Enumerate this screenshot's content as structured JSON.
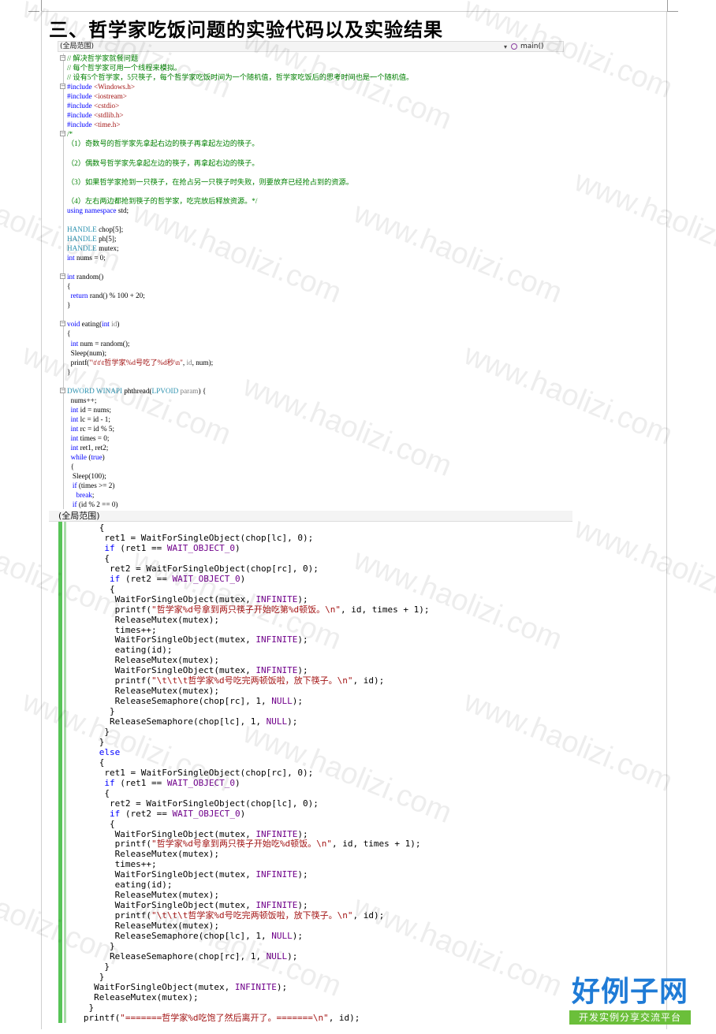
{
  "heading": "三、哲学家吃饭问题的实验代码以及实验结果",
  "top_editor": {
    "scope_label": "(全局范围)",
    "function_label": "main()",
    "lines": [
      [
        [
          "g",
          "// 解决哲学家就餐问题"
        ]
      ],
      [
        [
          "g",
          "// 每个哲学家可用一个线程来模拟。"
        ]
      ],
      [
        [
          "g",
          "// 设有5个哲学家，5只筷子，每个哲学家吃饭时间为一个随机值，哲学家吃饭后的思考时间也是一个随机值。"
        ]
      ],
      [
        [
          "b",
          "#include "
        ],
        [
          "s",
          "<Windows.h>"
        ]
      ],
      [
        [
          "b",
          "#include "
        ],
        [
          "s",
          "<iostream>"
        ]
      ],
      [
        [
          "b",
          "#include "
        ],
        [
          "s",
          "<cstdio>"
        ]
      ],
      [
        [
          "b",
          "#include "
        ],
        [
          "s",
          "<stdlib.h>"
        ]
      ],
      [
        [
          "b",
          "#include "
        ],
        [
          "s",
          "<time.h>"
        ]
      ],
      [
        [
          "g",
          "/*"
        ]
      ],
      [
        [
          "g",
          "（1）奇数号的哲学家先拿起右边的筷子再拿起左边的筷子。"
        ]
      ],
      [
        [
          "n",
          ""
        ]
      ],
      [
        [
          "g",
          "（2）偶数号哲学家先拿起左边的筷子，再拿起右边的筷子。"
        ]
      ],
      [
        [
          "n",
          ""
        ]
      ],
      [
        [
          "g",
          "（3）如果哲学家抢到一只筷子，在抢占另一只筷子时失败，则要放弃已经抢占到的资源。"
        ]
      ],
      [
        [
          "n",
          ""
        ]
      ],
      [
        [
          "g",
          "（4）左右两边都抢到筷子的哲学家，吃完放后释放资源。*/"
        ]
      ],
      [
        [
          "k",
          "using namespace"
        ],
        [
          "n",
          " std;"
        ]
      ],
      [
        [
          "n",
          ""
        ]
      ],
      [
        [
          "t",
          "HANDLE"
        ],
        [
          "n",
          " chop[5];"
        ]
      ],
      [
        [
          "t",
          "HANDLE"
        ],
        [
          "n",
          " ph[5];"
        ]
      ],
      [
        [
          "t",
          "HANDLE"
        ],
        [
          "n",
          " mutex;"
        ]
      ],
      [
        [
          "k",
          "int"
        ],
        [
          "n",
          " nums = 0;"
        ]
      ],
      [
        [
          "n",
          ""
        ]
      ],
      [
        [
          "k",
          "int"
        ],
        [
          "n",
          " random()"
        ]
      ],
      [
        [
          "n",
          "{"
        ]
      ],
      [
        [
          "n",
          "  "
        ],
        [
          "k",
          "return"
        ],
        [
          "n",
          " rand() % 100 + 20;"
        ]
      ],
      [
        [
          "n",
          "}"
        ]
      ],
      [
        [
          "n",
          ""
        ]
      ],
      [
        [
          "k",
          "void"
        ],
        [
          "n",
          " eating("
        ],
        [
          "k",
          "int"
        ],
        [
          "p",
          " id"
        ],
        [
          "n",
          ")"
        ]
      ],
      [
        [
          "n",
          "{"
        ]
      ],
      [
        [
          "n",
          "  "
        ],
        [
          "k",
          "int"
        ],
        [
          "n",
          " num = random();"
        ]
      ],
      [
        [
          "n",
          "  Sleep(num);"
        ]
      ],
      [
        [
          "n",
          "  printf("
        ],
        [
          "s",
          "\"\\t\\t\\t哲学家%d号吃了%d秒\\n\""
        ],
        [
          "n",
          ", "
        ],
        [
          "p",
          "id"
        ],
        [
          "n",
          ", num);"
        ]
      ],
      [
        [
          "n",
          "}"
        ]
      ],
      [
        [
          "n",
          ""
        ]
      ],
      [
        [
          "t",
          "DWORD WINAPI"
        ],
        [
          "n",
          " phthread("
        ],
        [
          "t",
          "LPVOID"
        ],
        [
          "p",
          " param"
        ],
        [
          "n",
          ") {"
        ]
      ],
      [
        [
          "n",
          "  nums++;"
        ]
      ],
      [
        [
          "n",
          "  "
        ],
        [
          "k",
          "int"
        ],
        [
          "n",
          " id = nums;"
        ]
      ],
      [
        [
          "n",
          "  "
        ],
        [
          "k",
          "int"
        ],
        [
          "n",
          " lc = id - 1;"
        ]
      ],
      [
        [
          "n",
          "  "
        ],
        [
          "k",
          "int"
        ],
        [
          "n",
          " rc = id % 5;"
        ]
      ],
      [
        [
          "n",
          "  "
        ],
        [
          "k",
          "int"
        ],
        [
          "n",
          " times = 0;"
        ]
      ],
      [
        [
          "n",
          "  "
        ],
        [
          "k",
          "int"
        ],
        [
          "n",
          " ret1, ret2;"
        ]
      ],
      [
        [
          "n",
          "  "
        ],
        [
          "k",
          "while"
        ],
        [
          "n",
          " ("
        ],
        [
          "k",
          "true"
        ],
        [
          "n",
          ")"
        ]
      ],
      [
        [
          "n",
          "  {"
        ]
      ],
      [
        [
          "n",
          "   Sleep(100);"
        ]
      ],
      [
        [
          "n",
          "   "
        ],
        [
          "k",
          "if"
        ],
        [
          "n",
          " (times >= 2)"
        ]
      ],
      [
        [
          "n",
          "     "
        ],
        [
          "k",
          "break"
        ],
        [
          "n",
          ";"
        ]
      ],
      [
        [
          "n",
          "   "
        ],
        [
          "k",
          "if"
        ],
        [
          "n",
          " (id % 2 == 0)"
        ]
      ]
    ]
  },
  "bottom_editor": {
    "scope_label": "(全局范围)",
    "lines": [
      [
        [
          "n",
          "      {"
        ]
      ],
      [
        [
          "n",
          "       ret1 = WaitForSingleObject(chop[lc], 0);"
        ]
      ],
      [
        [
          "n",
          "       "
        ],
        [
          "k",
          "if"
        ],
        [
          "n",
          " (ret1 == "
        ],
        [
          "m",
          "WAIT_OBJECT_0"
        ],
        [
          "n",
          ")"
        ]
      ],
      [
        [
          "n",
          "       {"
        ]
      ],
      [
        [
          "n",
          "        ret2 = WaitForSingleObject(chop[rc], 0);"
        ]
      ],
      [
        [
          "n",
          "        "
        ],
        [
          "k",
          "if"
        ],
        [
          "n",
          " (ret2 == "
        ],
        [
          "m",
          "WAIT_OBJECT_0"
        ],
        [
          "n",
          ")"
        ]
      ],
      [
        [
          "n",
          "        {"
        ]
      ],
      [
        [
          "n",
          "         WaitForSingleObject(mutex, "
        ],
        [
          "m",
          "INFINITE"
        ],
        [
          "n",
          ");"
        ]
      ],
      [
        [
          "n",
          "         printf("
        ],
        [
          "s",
          "\"哲学家%d号拿到两只筷子开始吃第%d顿饭。\\n\""
        ],
        [
          "n",
          ", id, times + 1);"
        ]
      ],
      [
        [
          "n",
          "         ReleaseMutex(mutex);"
        ]
      ],
      [
        [
          "n",
          "         times++;"
        ]
      ],
      [
        [
          "n",
          "         WaitForSingleObject(mutex, "
        ],
        [
          "m",
          "INFINITE"
        ],
        [
          "n",
          ");"
        ]
      ],
      [
        [
          "n",
          "         eating(id);"
        ]
      ],
      [
        [
          "n",
          "         ReleaseMutex(mutex);"
        ]
      ],
      [
        [
          "n",
          "         WaitForSingleObject(mutex, "
        ],
        [
          "m",
          "INFINITE"
        ],
        [
          "n",
          ");"
        ]
      ],
      [
        [
          "n",
          "         printf("
        ],
        [
          "s",
          "\"\\t\\t\\t哲学家%d号吃完两顿饭啦，放下筷子。\\n\""
        ],
        [
          "n",
          ", id);"
        ]
      ],
      [
        [
          "n",
          "         ReleaseMutex(mutex);"
        ]
      ],
      [
        [
          "n",
          "         ReleaseSemaphore(chop[rc], 1, "
        ],
        [
          "m",
          "NULL"
        ],
        [
          "n",
          ");"
        ]
      ],
      [
        [
          "n",
          "        }"
        ]
      ],
      [
        [
          "n",
          "        ReleaseSemaphore(chop[lc], 1, "
        ],
        [
          "m",
          "NULL"
        ],
        [
          "n",
          ");"
        ]
      ],
      [
        [
          "n",
          "       }"
        ]
      ],
      [
        [
          "n",
          "      }"
        ]
      ],
      [
        [
          "n",
          "      "
        ],
        [
          "k",
          "else"
        ]
      ],
      [
        [
          "n",
          "      {"
        ]
      ],
      [
        [
          "n",
          "       ret1 = WaitForSingleObject(chop[rc], 0);"
        ]
      ],
      [
        [
          "n",
          "       "
        ],
        [
          "k",
          "if"
        ],
        [
          "n",
          " (ret1 == "
        ],
        [
          "m",
          "WAIT_OBJECT_0"
        ],
        [
          "n",
          ")"
        ]
      ],
      [
        [
          "n",
          "       {"
        ]
      ],
      [
        [
          "n",
          "        ret2 = WaitForSingleObject(chop[lc], 0);"
        ]
      ],
      [
        [
          "n",
          "        "
        ],
        [
          "k",
          "if"
        ],
        [
          "n",
          " (ret2 == "
        ],
        [
          "m",
          "WAIT_OBJECT_0"
        ],
        [
          "n",
          ")"
        ]
      ],
      [
        [
          "n",
          "        {"
        ]
      ],
      [
        [
          "n",
          "         WaitForSingleObject(mutex, "
        ],
        [
          "m",
          "INFINITE"
        ],
        [
          "n",
          ");"
        ]
      ],
      [
        [
          "n",
          "         printf("
        ],
        [
          "s",
          "\"哲学家%d号拿到两只筷子开始吃%d顿饭。\\n\""
        ],
        [
          "n",
          ", id, times + 1);"
        ]
      ],
      [
        [
          "n",
          "         ReleaseMutex(mutex);"
        ]
      ],
      [
        [
          "n",
          "         times++;"
        ]
      ],
      [
        [
          "n",
          "         WaitForSingleObject(mutex, "
        ],
        [
          "m",
          "INFINITE"
        ],
        [
          "n",
          ");"
        ]
      ],
      [
        [
          "n",
          "         eating(id);"
        ]
      ],
      [
        [
          "n",
          "         ReleaseMutex(mutex);"
        ]
      ],
      [
        [
          "n",
          "         WaitForSingleObject(mutex, "
        ],
        [
          "m",
          "INFINITE"
        ],
        [
          "n",
          ");"
        ]
      ],
      [
        [
          "n",
          "         printf("
        ],
        [
          "s",
          "\"\\t\\t\\t哲学家%d号吃完两顿饭啦，放下筷子。\\n\""
        ],
        [
          "n",
          ", id);"
        ]
      ],
      [
        [
          "n",
          "         ReleaseMutex(mutex);"
        ]
      ],
      [
        [
          "n",
          "         ReleaseSemaphore(chop[lc], 1, "
        ],
        [
          "m",
          "NULL"
        ],
        [
          "n",
          ");"
        ]
      ],
      [
        [
          "n",
          "        }"
        ]
      ],
      [
        [
          "n",
          "        ReleaseSemaphore(chop[rc], 1, "
        ],
        [
          "m",
          "NULL"
        ],
        [
          "n",
          ");"
        ]
      ],
      [
        [
          "n",
          "       }"
        ]
      ],
      [
        [
          "n",
          "      }"
        ]
      ],
      [
        [
          "n",
          "     WaitForSingleObject(mutex, "
        ],
        [
          "m",
          "INFINITE"
        ],
        [
          "n",
          ");"
        ]
      ],
      [
        [
          "n",
          "     ReleaseMutex(mutex);"
        ]
      ],
      [
        [
          "n",
          "    }"
        ]
      ],
      [
        [
          "n",
          "   printf("
        ],
        [
          "s",
          "\"=======哲学家%d吃饱了然后离开了。=======\\n\""
        ],
        [
          "n",
          ", id);"
        ]
      ]
    ]
  },
  "watermark": "www.haolizi.com",
  "logo": {
    "title": "好例子网",
    "subtitle": "开发实例分享交流平台"
  }
}
